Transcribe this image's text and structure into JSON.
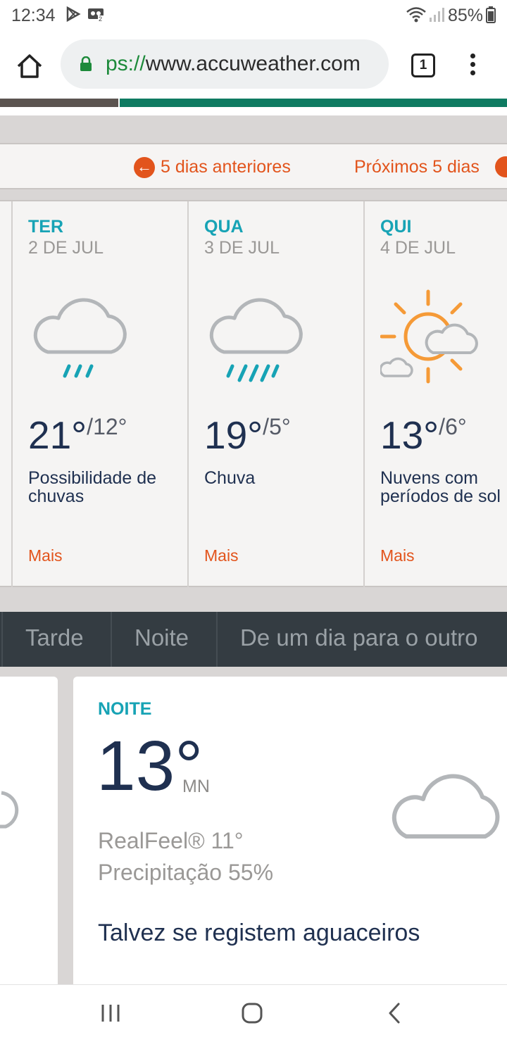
{
  "status_bar": {
    "time": "12:34",
    "battery": "85%"
  },
  "browser": {
    "url_scheme": "ps://",
    "url_host": "www.accuweather.com",
    "tab_count": "1"
  },
  "nav": {
    "prev_label": "5 dias anteriores",
    "next_label": "Próximos 5 dias"
  },
  "days": [
    {
      "dow": "TER",
      "date": "2 DE JUL",
      "high": "21°",
      "low": "/12°",
      "condition": "Possibilidade de chuvas",
      "more": "Mais",
      "icon": "rain-cloud-icon"
    },
    {
      "dow": "QUA",
      "date": "3 DE JUL",
      "high": "19°",
      "low": "/5°",
      "condition": "Chuva",
      "more": "Mais",
      "icon": "heavy-rain-cloud-icon"
    },
    {
      "dow": "QUI",
      "date": "4 DE JUL",
      "high": "13°",
      "low": "/6°",
      "condition": "Nuvens com períodos de sol",
      "more": "Mais",
      "icon": "sun-cloud-icon"
    }
  ],
  "period_tabs": [
    "Tarde",
    "Noite",
    "De um dia para o outro"
  ],
  "night": {
    "label": "NOITE",
    "temp": "13°",
    "unit": "MN",
    "realfeel": "RealFeel® 11°",
    "precip": "Precipitação 55%",
    "phrase": "Talvez se registem aguaceiros",
    "icon": "cloud-icon"
  },
  "colors": {
    "accent_teal": "#17a3b5",
    "link_orange": "#e2541c",
    "brand_green": "#0f7b62",
    "tab_bar": "#343c42"
  }
}
